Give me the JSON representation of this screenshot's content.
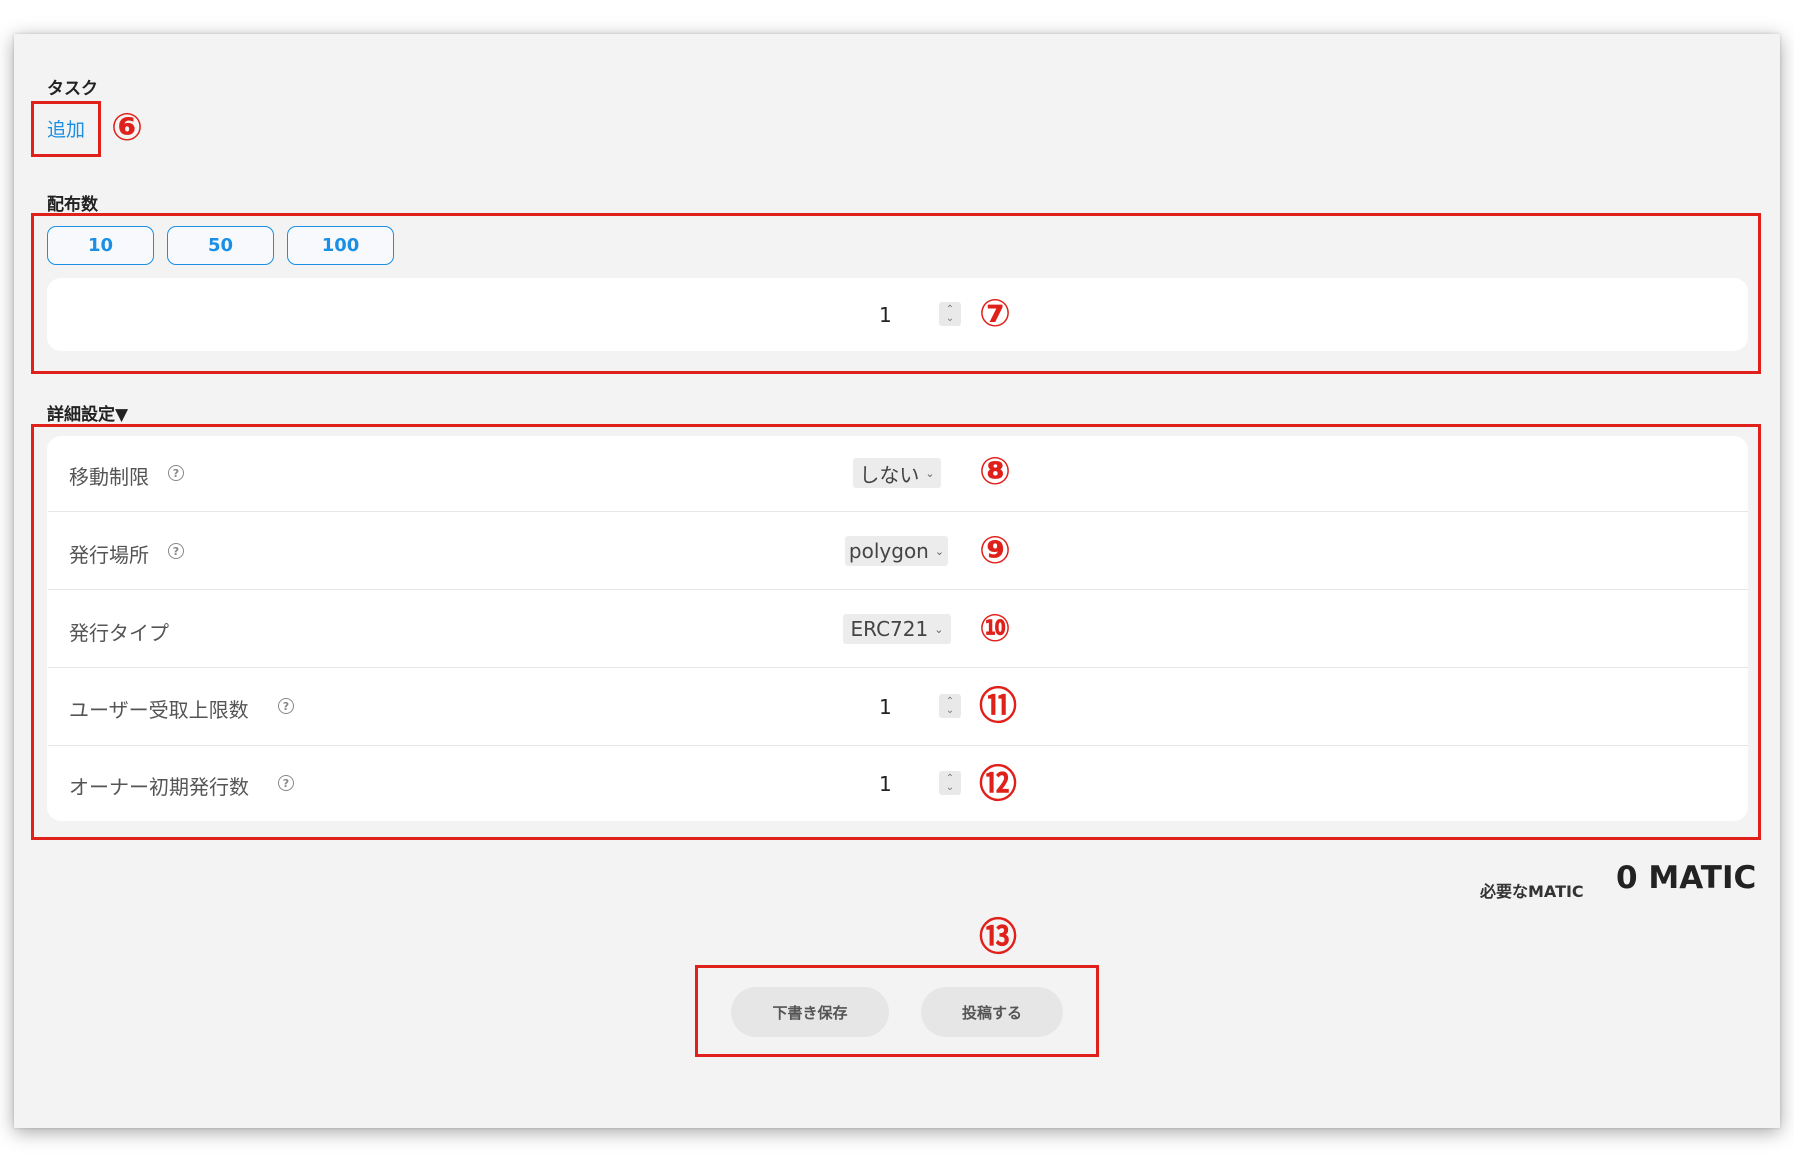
{
  "task": {
    "heading": "タスク",
    "add_label": "追加"
  },
  "distribution": {
    "heading": "配布数",
    "presets": [
      "10",
      "50",
      "100"
    ],
    "value": "1"
  },
  "advanced": {
    "heading": "詳細設定▼",
    "rows": [
      {
        "label": "移動制限",
        "value": "しない",
        "has_help": true
      },
      {
        "label": "発行場所",
        "value": "polygon",
        "has_help": true
      },
      {
        "label": "発行タイプ",
        "value": "ERC721",
        "has_help": false
      },
      {
        "label": "ユーザー受取上限数",
        "value": "1",
        "has_help": true
      },
      {
        "label": "オーナー初期発行数",
        "value": "1",
        "has_help": true
      }
    ]
  },
  "cost": {
    "label": "必要なMATIC",
    "value": "0 MATIC"
  },
  "actions": {
    "draft_label": "下書き保存",
    "post_label": "投稿する"
  },
  "annotations": {
    "m6": "⑥",
    "m7": "⑦",
    "m8": "⑧",
    "m9": "⑨",
    "m10": "⑩",
    "m11": "⑪",
    "m12": "⑫",
    "m13": "⑬"
  },
  "colors": {
    "accent": "#1a8fe3",
    "annotation_red": "#e0201a",
    "panel_bg": "#f3f3f3"
  },
  "icons": {
    "help": "question-circle-icon",
    "stepper": "up-down-arrows-icon",
    "dropdown": "chevron-down-icon"
  }
}
